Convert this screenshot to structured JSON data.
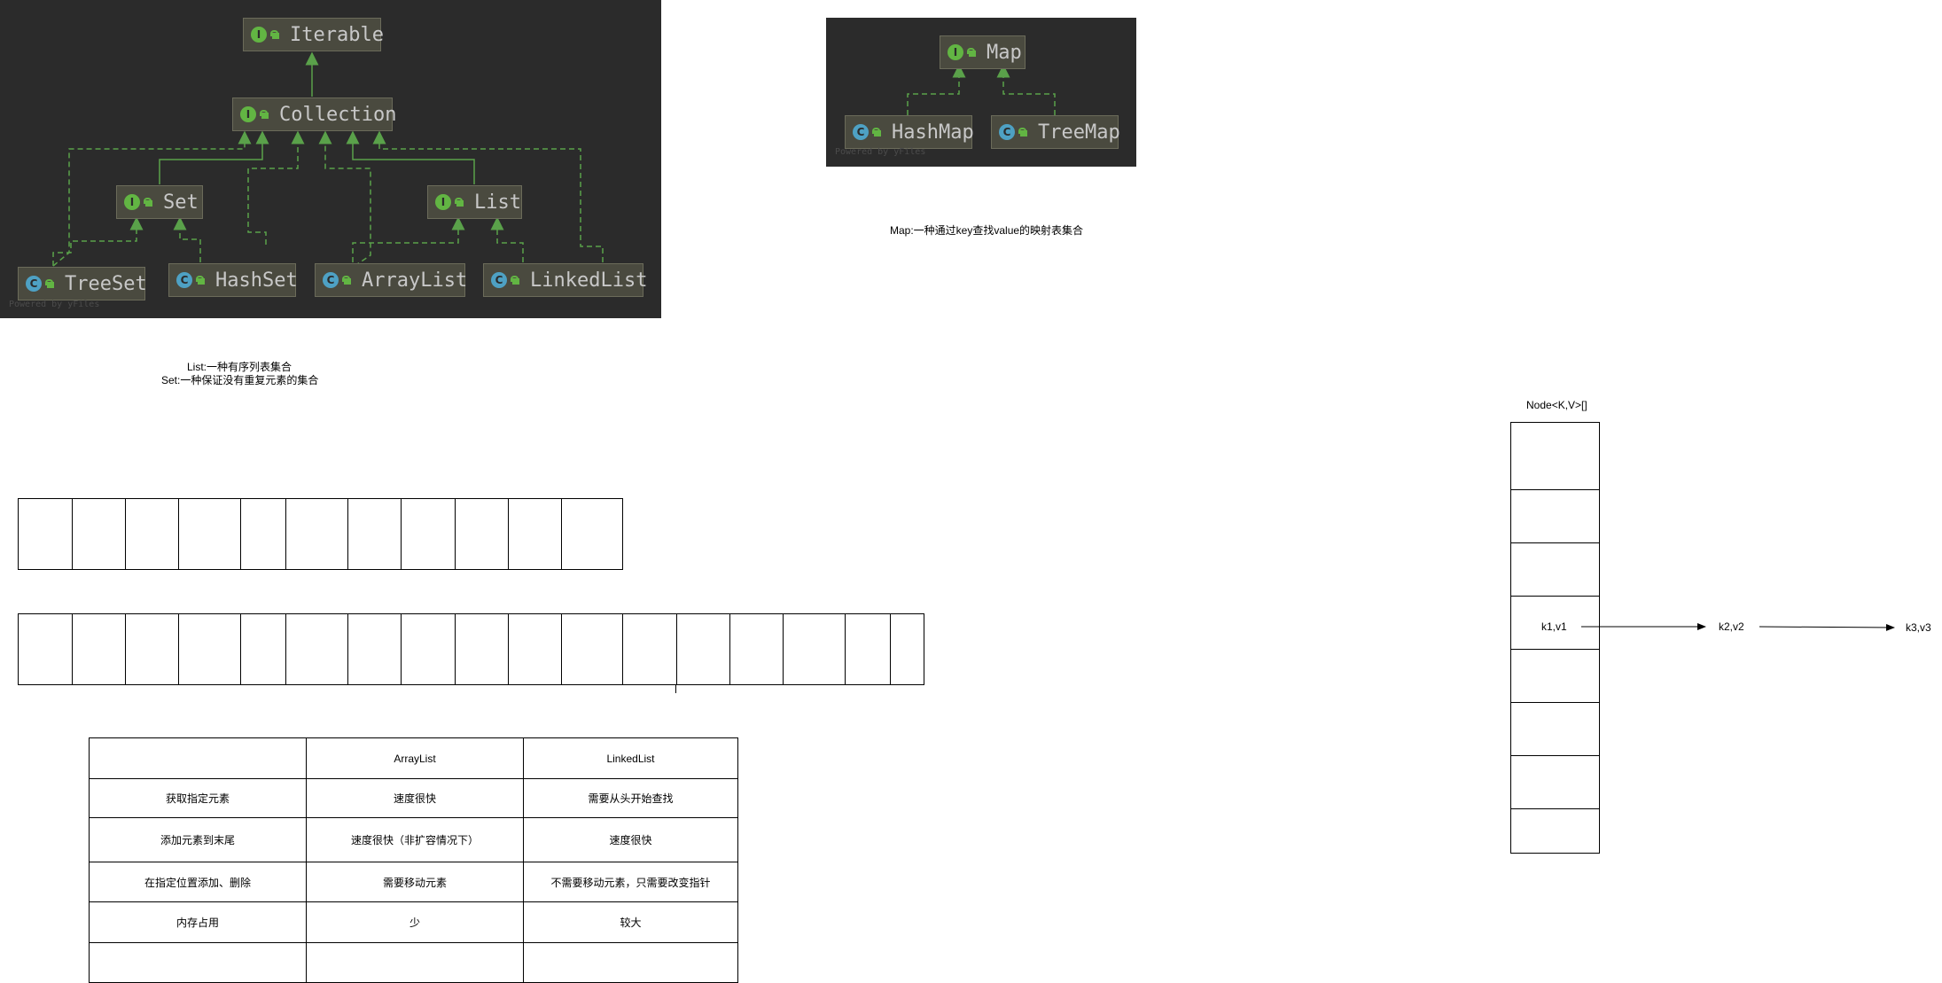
{
  "collection_panel": {
    "nodes": {
      "iterable": {
        "label": "Iterable",
        "kind": "I"
      },
      "collection": {
        "label": "Collection",
        "kind": "I"
      },
      "set": {
        "label": "Set",
        "kind": "I"
      },
      "list": {
        "label": "List",
        "kind": "I"
      },
      "treeset": {
        "label": "TreeSet",
        "kind": "C"
      },
      "hashset": {
        "label": "HashSet",
        "kind": "C"
      },
      "arraylist": {
        "label": "ArrayList",
        "kind": "C"
      },
      "linkedlist": {
        "label": "LinkedList",
        "kind": "C"
      }
    },
    "watermark": "Powered by yFiles"
  },
  "map_panel": {
    "nodes": {
      "map": {
        "label": "Map",
        "kind": "I"
      },
      "hashmap": {
        "label": "HashMap",
        "kind": "C"
      },
      "treemap": {
        "label": "TreeMap",
        "kind": "C"
      }
    },
    "watermark": "Powered by yFiles"
  },
  "colors": {
    "panel": "#2b2b2b",
    "edge": "#5aa14a",
    "interface_icon": "#62b543",
    "class_icon": "#4ea1c4"
  },
  "notes": {
    "map_desc": "Map:一种通过key查找value的映射表集合",
    "list_desc": "List:一种有序列表集合",
    "set_desc": "Set:一种保证没有重复元素的集合"
  },
  "compare_table": {
    "header": [
      "",
      "ArrayList",
      "LinkedList"
    ],
    "rows": [
      [
        "获取指定元素",
        "速度很快",
        "需要从头开始查找"
      ],
      [
        "添加元素到末尾",
        "速度很快（非扩容情况下）",
        "速度很快"
      ],
      [
        "在指定位置添加、删除",
        "需要移动元素",
        "不需要移动元素，只需要改变指针"
      ],
      [
        "内存占用",
        "少",
        "较大"
      ],
      [
        "",
        "",
        ""
      ]
    ]
  },
  "hashmap_diagram": {
    "array_label": "Node<K,V>[]",
    "entries": [
      "k1,v1",
      "k2,v2",
      "k3,v3"
    ]
  }
}
